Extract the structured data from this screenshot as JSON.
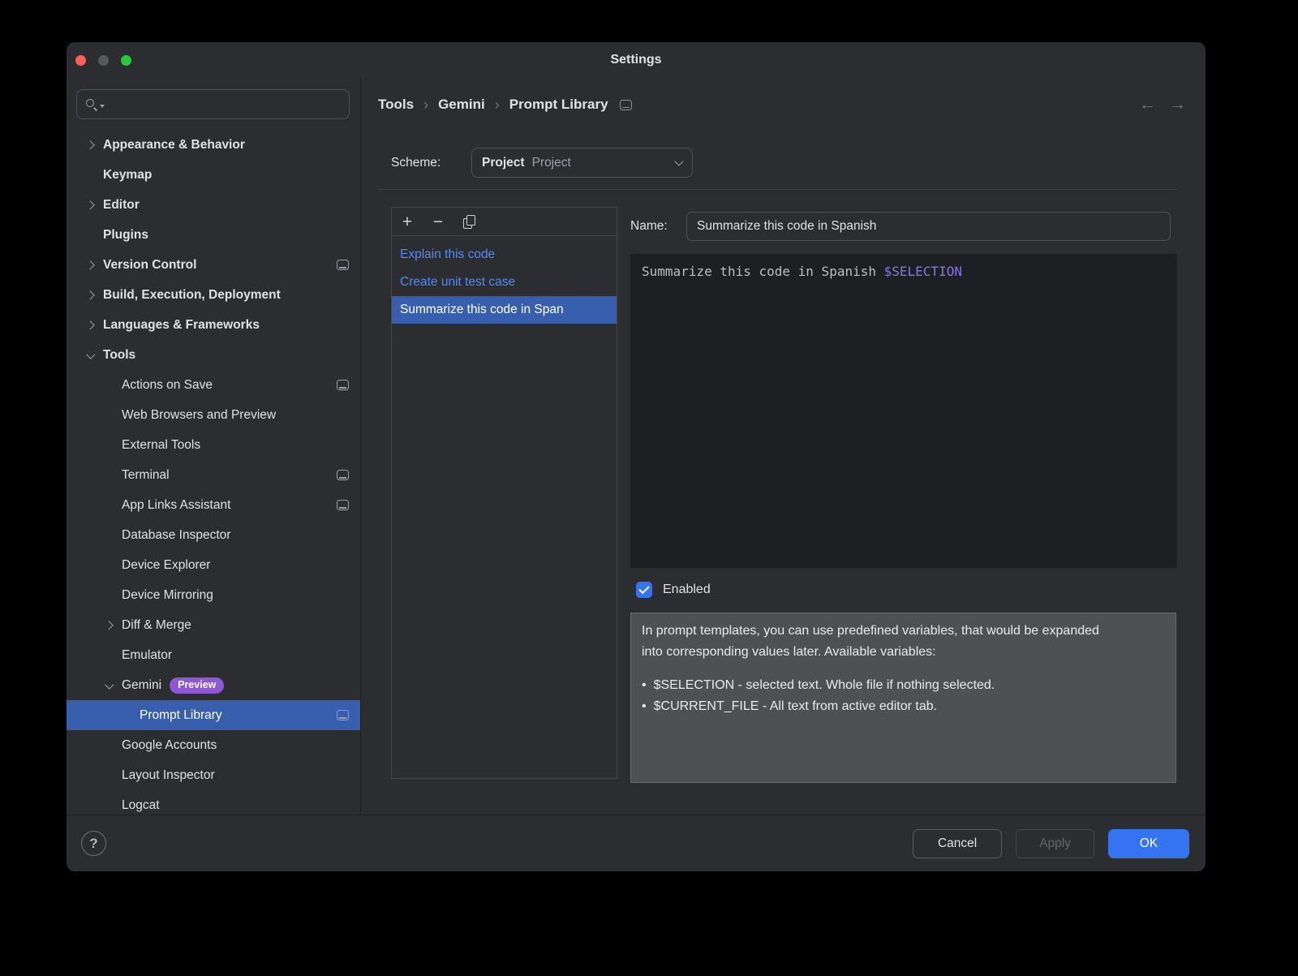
{
  "window": {
    "title": "Settings"
  },
  "icons": {
    "back": "←",
    "forward": "→",
    "help": "?",
    "add": "+",
    "remove": "−",
    "crumb_sep": "›"
  },
  "colors": {
    "window_bg": "#2b2d30",
    "editor_bg": "#1e1f22",
    "accent_blue": "#3574f0",
    "selection_blue": "#375fad",
    "link_blue": "#548af7",
    "badge_purple": "#8e57d4",
    "variable_purple": "#8b74e8",
    "help_panel_bg": "#4d5154"
  },
  "sidebar": {
    "search_placeholder": "",
    "items": [
      {
        "label": "Appearance & Behavior",
        "level": 0,
        "chevron": "right"
      },
      {
        "label": "Keymap",
        "level": 0
      },
      {
        "label": "Editor",
        "level": 0,
        "chevron": "right"
      },
      {
        "label": "Plugins",
        "level": 0
      },
      {
        "label": "Version Control",
        "level": 0,
        "chevron": "right",
        "trailing_icon": true
      },
      {
        "label": "Build, Execution, Deployment",
        "level": 0,
        "chevron": "right"
      },
      {
        "label": "Languages & Frameworks",
        "level": 0,
        "chevron": "right"
      },
      {
        "label": "Tools",
        "level": 0,
        "chevron": "down"
      },
      {
        "label": "Actions on Save",
        "level": 1,
        "trailing_icon": true
      },
      {
        "label": "Web Browsers and Preview",
        "level": 1
      },
      {
        "label": "External Tools",
        "level": 1
      },
      {
        "label": "Terminal",
        "level": 1,
        "trailing_icon": true
      },
      {
        "label": "App Links Assistant",
        "level": 1,
        "trailing_icon": true
      },
      {
        "label": "Database Inspector",
        "level": 1
      },
      {
        "label": "Device Explorer",
        "level": 1
      },
      {
        "label": "Device Mirroring",
        "level": 1
      },
      {
        "label": "Diff & Merge",
        "level": 1,
        "chevron": "right"
      },
      {
        "label": "Emulator",
        "level": 1
      },
      {
        "label": "Gemini",
        "level": 1,
        "chevron": "down",
        "badge": "Preview"
      },
      {
        "label": "Prompt Library",
        "level": 2,
        "selected": true,
        "trailing_icon": true
      },
      {
        "label": "Google Accounts",
        "level": 1
      },
      {
        "label": "Layout Inspector",
        "level": 1
      },
      {
        "label": "Logcat",
        "level": 1
      }
    ]
  },
  "breadcrumb": {
    "items": [
      "Tools",
      "Gemini",
      "Prompt Library"
    ]
  },
  "scheme": {
    "label": "Scheme:",
    "value": "Project",
    "placeholder": "Project"
  },
  "prompt_list": {
    "items": [
      {
        "label": "Explain this code",
        "selected": false
      },
      {
        "label": "Create unit test case",
        "selected": false
      },
      {
        "label": "Summarize this code in Span",
        "selected": true
      }
    ]
  },
  "editor": {
    "name_label": "Name:",
    "name_value": "Summarize this code in Spanish",
    "prompt_text": "Summarize this code in Spanish ",
    "prompt_variable": "$SELECTION",
    "enabled_label": "Enabled"
  },
  "help_panel": {
    "intro": "In prompt templates, you can use predefined variables, that would be expanded into corresponding values later. Available variables:",
    "variables": [
      "$SELECTION - selected text. Whole file if nothing selected.",
      "$CURRENT_FILE - All text from active editor tab."
    ]
  },
  "footer": {
    "cancel": "Cancel",
    "apply": "Apply",
    "ok": "OK"
  }
}
